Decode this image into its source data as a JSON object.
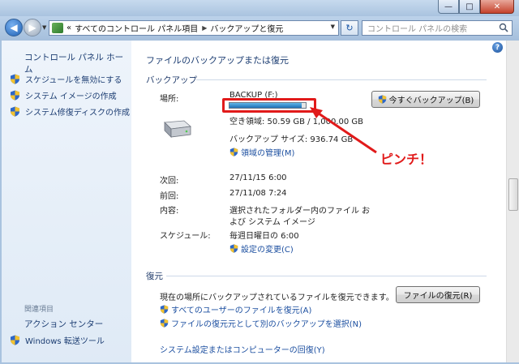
{
  "window": {
    "minimize_label": "—",
    "maximize_label": "□",
    "close_label": "✕"
  },
  "address": {
    "prefix": "«",
    "segment1": "すべてのコントロール パネル項目",
    "segment2": "バックアップと復元"
  },
  "search": {
    "placeholder": "コントロール パネルの検索"
  },
  "sidebar": {
    "home": "コントロール パネル ホーム",
    "items": [
      {
        "label": "スケジュールを無効にする",
        "icon": "shield-icon"
      },
      {
        "label": "システム イメージの作成",
        "icon": "shield-icon"
      },
      {
        "label": "システム修復ディスクの作成",
        "icon": "shield-icon"
      }
    ],
    "related_heading": "関連項目",
    "related": [
      {
        "label": "アクション センター"
      },
      {
        "label": "Windows 転送ツール",
        "icon": "shield-icon"
      }
    ]
  },
  "main": {
    "title": "ファイルのバックアップまたは復元",
    "backup_heading": "バックアップ",
    "location_label": "場所:",
    "location_value": "BACKUP (F:)",
    "backup_now_button": "今すぐバックアップ(B)",
    "drive_usage_percent": 95,
    "free_space": "空き領域: 50.59 GB / 1,000.00 GB",
    "backup_size": "バックアップ サイズ: 936.74 GB",
    "manage_space_link": "領域の管理(M)",
    "next_label": "次回:",
    "next_value": "27/11/15 6:00",
    "last_label": "前回:",
    "last_value": "27/11/08 7:24",
    "contents_label": "内容:",
    "contents_line1": "選択されたフォルダー内のファイル お",
    "contents_line2": "よび システム イメージ",
    "schedule_label": "スケジュール:",
    "schedule_value": "毎週日曜日の 6:00",
    "change_settings_link": "設定の変更(C)",
    "restore_heading": "復元",
    "restore_text": "現在の場所にバックアップされているファイルを復元できます。",
    "restore_files_button": "ファイルの復元(R)",
    "restore_all_users_link": "すべてのユーザーのファイルを復元(A)",
    "select_other_backup_link": "ファイルの復元元として別のバックアップを選択(N)",
    "recover_system_link": "システム設定またはコンピューターの回復(Y)"
  },
  "annotation": {
    "text": "ピンチ！",
    "color": "#e11a1a"
  },
  "help_label": "?"
}
